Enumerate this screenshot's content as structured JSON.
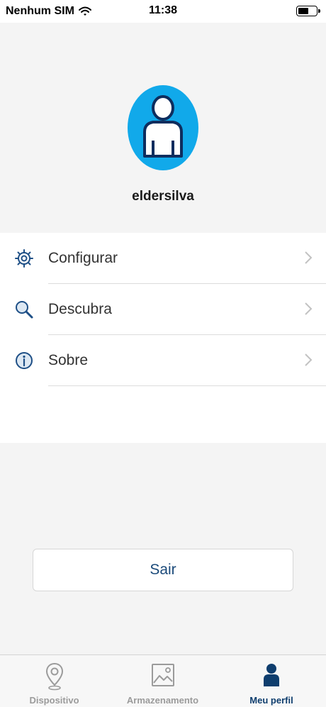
{
  "status_bar": {
    "carrier": "Nenhum SIM",
    "time": "11:38"
  },
  "profile": {
    "username": "eldersilva",
    "avatar_color": "#11a9ea"
  },
  "menu": {
    "items": [
      {
        "label": "Configurar",
        "icon": "gear-icon"
      },
      {
        "label": "Descubra",
        "icon": "magnifier-icon"
      },
      {
        "label": "Sobre",
        "icon": "info-icon"
      }
    ]
  },
  "logout": {
    "label": "Sair"
  },
  "tabbar": {
    "tabs": [
      {
        "label": "Dispositivo",
        "icon": "location-pin-icon",
        "active": false
      },
      {
        "label": "Armazenamento",
        "icon": "image-icon",
        "active": false
      },
      {
        "label": "Meu perfil",
        "icon": "person-icon",
        "active": true
      }
    ],
    "active_color": "#0f3e6e",
    "inactive_color": "#9b9b9b"
  }
}
